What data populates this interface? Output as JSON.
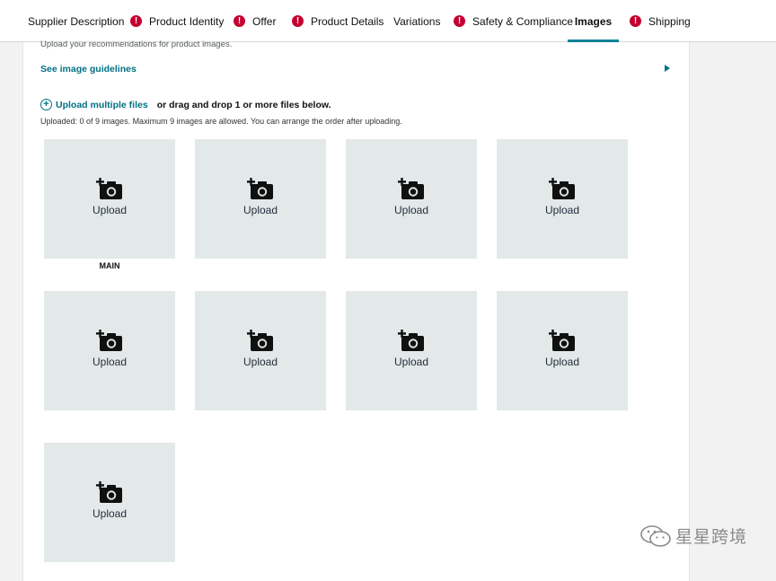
{
  "tabs": [
    {
      "label": "Supplier Description",
      "error": false,
      "active": false
    },
    {
      "label": "Product Identity",
      "error": true,
      "active": false
    },
    {
      "label": "Offer",
      "error": true,
      "active": false
    },
    {
      "label": "Product Details",
      "error": true,
      "active": false
    },
    {
      "label": "Variations",
      "error": false,
      "active": false
    },
    {
      "label": "Safety & Compliance",
      "error": true,
      "active": false
    },
    {
      "label": "Images",
      "error": false,
      "active": true
    },
    {
      "label": "Shipping",
      "error": true,
      "active": false
    }
  ],
  "error_icon_glyph": "!",
  "intro_text": "Upload your recommendations for product images.",
  "guidelines_link": "See image guidelines",
  "upload_link": "Upload multiple files",
  "drag_text": "or drag and drop 1 or more files below.",
  "counter_text": "Uploaded: 0 of 9 images. Maximum 9 images are allowed. You can arrange the order after uploading.",
  "slots": [
    {
      "label": "Upload"
    },
    {
      "label": "Upload"
    },
    {
      "label": "Upload"
    },
    {
      "label": "Upload"
    },
    {
      "label": "Upload"
    },
    {
      "label": "Upload"
    },
    {
      "label": "Upload"
    },
    {
      "label": "Upload"
    },
    {
      "label": "Upload"
    }
  ],
  "main_label": "MAIN",
  "watermark_text": "星星跨境",
  "colors": {
    "accent": "#008296",
    "link": "#007185",
    "error": "#c40030",
    "slot_bg": "#e3e8e8"
  },
  "icons": {
    "slot": "add-photo-camera-icon",
    "error": "exclamation-circle-icon",
    "upload": "plus-circle-icon",
    "expand": "caret-right-icon",
    "watermark": "wechat-icon"
  }
}
